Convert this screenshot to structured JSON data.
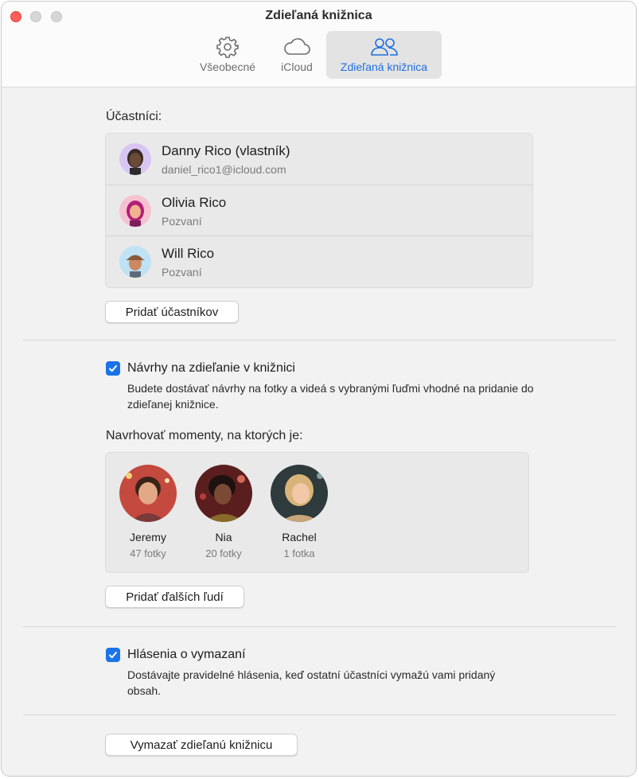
{
  "window": {
    "title": "Zdieľaná knižnica"
  },
  "tabs": [
    {
      "label": "Všeobecné",
      "icon": "gear-icon"
    },
    {
      "label": "iCloud",
      "icon": "cloud-icon"
    },
    {
      "label": "Zdieľaná knižnica",
      "icon": "people-icon",
      "selected": true
    }
  ],
  "participants": {
    "heading": "Účastníci:",
    "items": [
      {
        "name": "Danny Rico (vlastník)",
        "detail": "daniel_rico1@icloud.com"
      },
      {
        "name": "Olivia Rico",
        "detail": "Pozvaní"
      },
      {
        "name": "Will Rico",
        "detail": "Pozvaní"
      }
    ],
    "add_button": "Pridať účastníkov"
  },
  "suggestions": {
    "checked": true,
    "title": "Návrhy na zdieľanie v knižnici",
    "description": "Budete dostávať návrhy na fotky a videá s vybranými ľuďmi vhodné na pridanie do zdieľanej knižnice."
  },
  "moments": {
    "heading": "Navrhovať momenty, na ktorých je:",
    "people": [
      {
        "name": "Jeremy",
        "count": "47 fotky"
      },
      {
        "name": "Nia",
        "count": "20 fotky"
      },
      {
        "name": "Rachel",
        "count": "1 fotka"
      }
    ],
    "add_button": "Pridať ďalších ľudí"
  },
  "deletion": {
    "checked": true,
    "title": "Hlásenia o vymazaní",
    "description": "Dostávajte pravidelné hlásenia, keď ostatní účastníci vymažú vami pridaný obsah."
  },
  "delete_button": "Vymazať zdieľanú knižnicu",
  "colors": {
    "accent": "#1a73e8",
    "close": "#ff5f57"
  }
}
